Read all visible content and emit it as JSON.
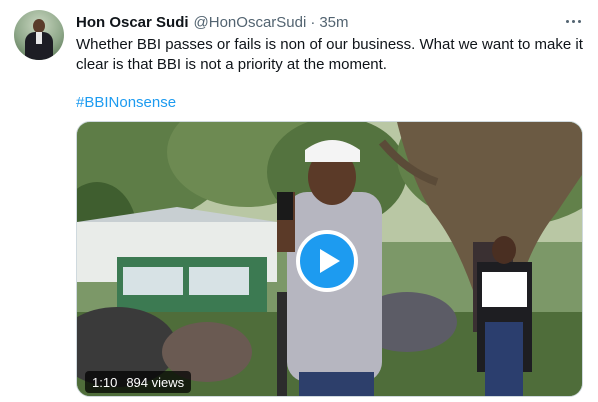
{
  "tweet": {
    "author_name": "Hon Oscar Sudi",
    "author_handle": "@HonOscarSudi",
    "separator": "·",
    "timestamp": "35m",
    "text": "Whether BBI passes or fails is non of our business. What we want to make it clear is that BBI is not a priority at the moment.",
    "hashtag": "#BBINonsense",
    "video": {
      "duration": "1:10",
      "views": "894 views"
    }
  },
  "colors": {
    "link": "#1d9bf0",
    "secondary_text": "#536471",
    "play_button": "#1d9bf0"
  },
  "icons": [
    "more-options-icon",
    "play-icon"
  ]
}
